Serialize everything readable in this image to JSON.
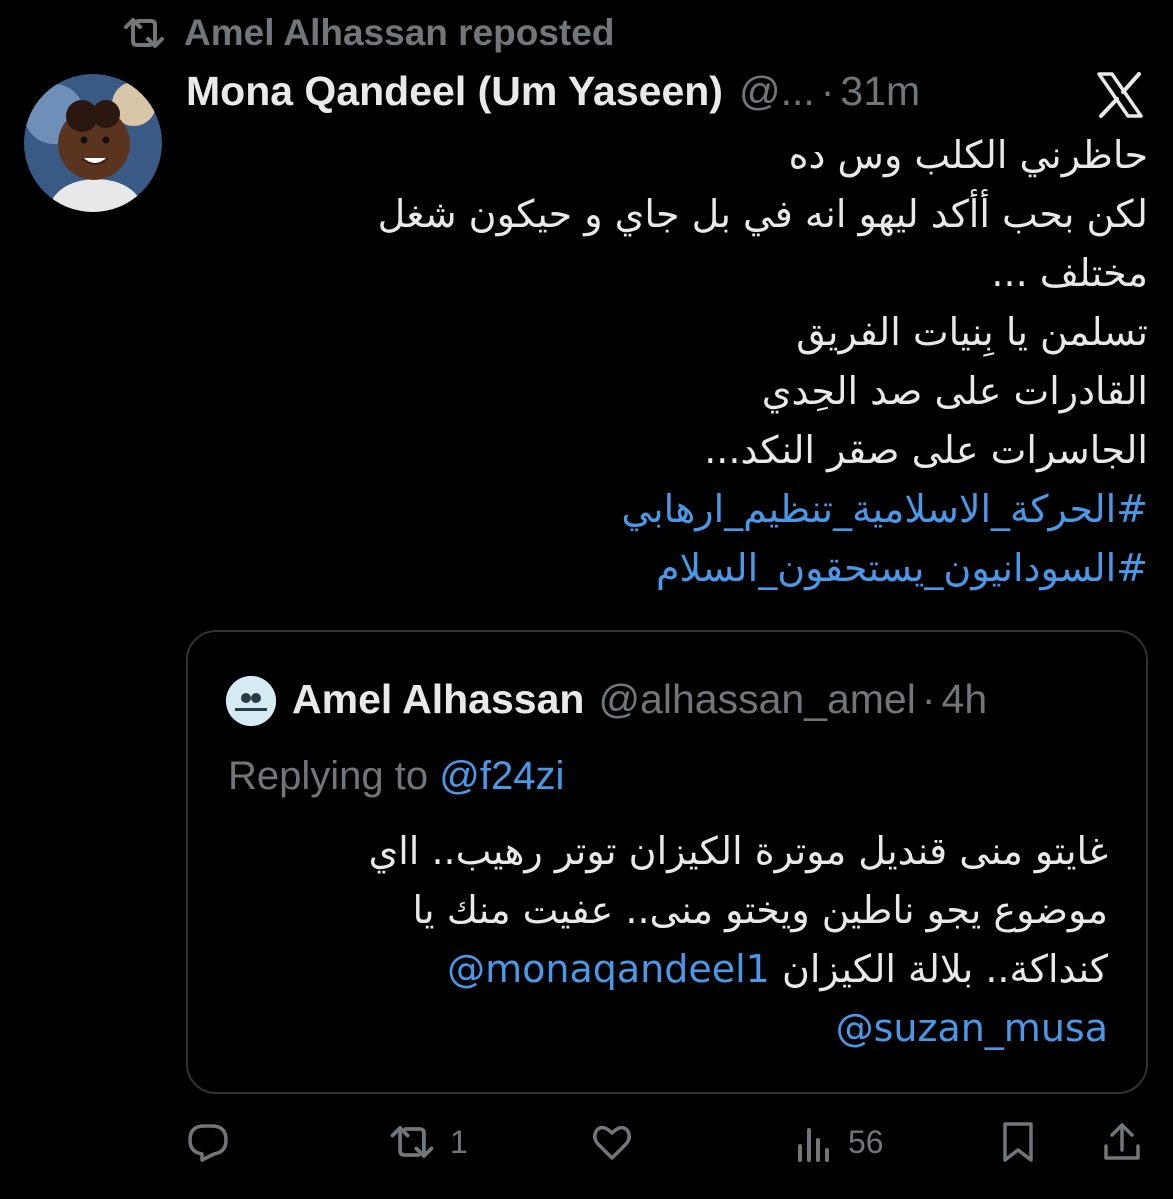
{
  "repost": {
    "icon": "repost-icon",
    "text": "Amel Alhassan reposted"
  },
  "tweet": {
    "display_name": "Mona Qandeel (Um Yaseen)",
    "handle": "@...",
    "separator": "·",
    "time": "31m",
    "lines": [
      "حاظرني الكلب وس ده",
      "لكن بحب أأكد ليهو انه في بل جاي و حيكون شغل",
      "مختلف ...",
      "تسلمن يا بِنيات الفريق",
      "القادرات على صد الحِدي",
      "الجاسرات على صقر النكد..."
    ],
    "hashtags": [
      "#الحركة_الاسلامية_تنظيم_ارهابي",
      "#السودانيون_يستحقون_السلام"
    ]
  },
  "quote": {
    "display_name": "Amel Alhassan",
    "handle": "@alhassan_amel",
    "separator": "·",
    "time": "4h",
    "replying_prefix": "Replying to",
    "replying_mention": "@f24zi",
    "lines": [
      "غايتو منى قنديل موترة الكيزان توتر رهيب.. ااي",
      "موضوع يجو ناطين ويختو منى.. عفيت منك يا"
    ],
    "line3_text": "كنداكة.. بلالة الكيزان",
    "mention_1": "@monaqandeel1",
    "mention_2": "@suzan_musa"
  },
  "actions": {
    "reply_icon": "reply-icon",
    "repost_icon": "repost-icon",
    "repost_count": "1",
    "like_icon": "heart-icon",
    "views_icon": "views-icon",
    "views_count": "56",
    "bookmark_icon": "bookmark-icon",
    "share_icon": "share-icon"
  },
  "colors": {
    "background": "#000000",
    "text": "#e7e9ea",
    "muted": "#71767b",
    "link": "#4a99e9",
    "border": "#2f3336"
  }
}
